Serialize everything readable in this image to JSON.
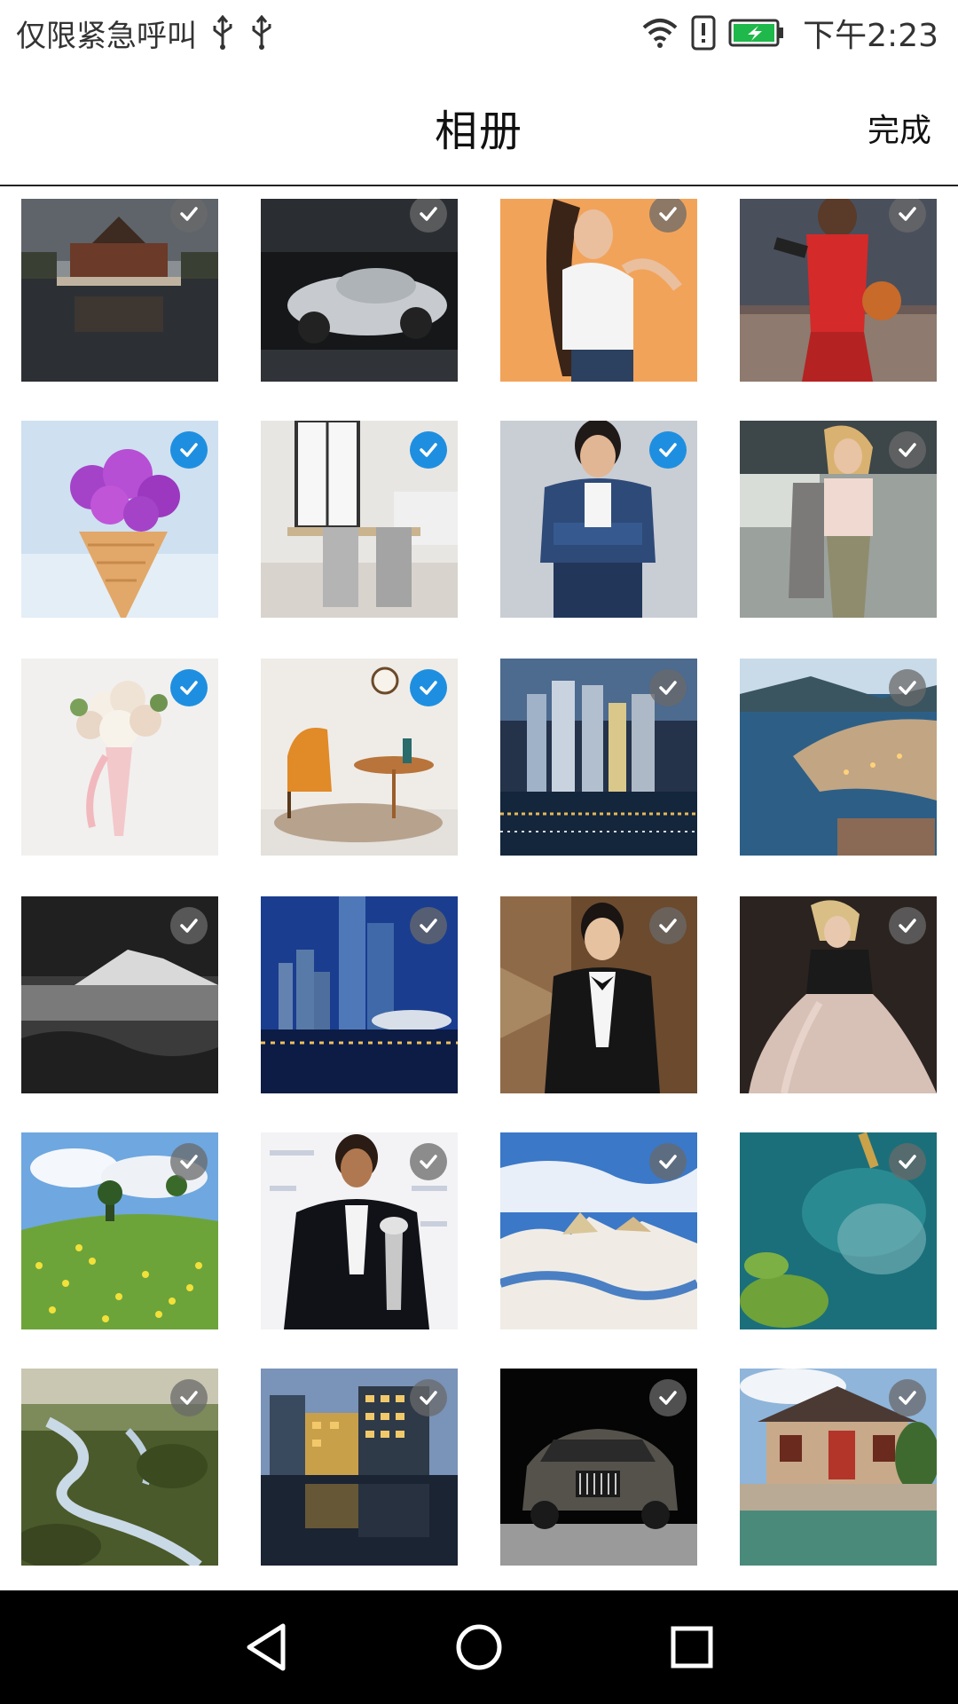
{
  "status_bar": {
    "carrier_text": "仅限紧急呼叫",
    "time": "下午2:23",
    "icons": [
      "usb-icon",
      "usb-icon",
      "wifi-icon",
      "alert-icon",
      "battery-charging-icon"
    ]
  },
  "header": {
    "title": "相册",
    "done_label": "完成"
  },
  "colors": {
    "selected_check": "#1e8fe0",
    "unselected_check": "#696969",
    "nav_bar": "#000000"
  },
  "gallery": {
    "rows": [
      {
        "items": [
          {
            "subject": "palace-tower-reflection",
            "selected": false
          },
          {
            "subject": "silver-sports-car",
            "selected": false
          },
          {
            "subject": "woman-orange-background",
            "selected": false
          },
          {
            "subject": "basketball-player",
            "selected": false
          }
        ]
      },
      {
        "items": [
          {
            "subject": "flower-cone",
            "selected": true
          },
          {
            "subject": "dining-room",
            "selected": true
          },
          {
            "subject": "man-denim-jacket",
            "selected": true
          },
          {
            "subject": "woman-olive-pants",
            "selected": false
          }
        ]
      },
      {
        "items": [
          {
            "subject": "rose-bouquet",
            "selected": true
          },
          {
            "subject": "orange-chair-table",
            "selected": true
          },
          {
            "subject": "city-night-harbor",
            "selected": false
          },
          {
            "subject": "lakeside-town",
            "selected": false
          }
        ]
      },
      {
        "items": [
          {
            "subject": "black-white-mountain",
            "selected": false
          },
          {
            "subject": "blue-skyscrapers",
            "selected": false
          },
          {
            "subject": "man-tuxedo-stairs",
            "selected": false
          },
          {
            "subject": "woman-gown-jacket",
            "selected": false
          }
        ]
      },
      {
        "items": [
          {
            "subject": "dandelion-meadow",
            "selected": false
          },
          {
            "subject": "man-trophy",
            "selected": false
          },
          {
            "subject": "desert-rocks",
            "selected": false
          },
          {
            "subject": "aerial-sea-boat",
            "selected": false
          }
        ]
      },
      {
        "items": [
          {
            "subject": "river-valley",
            "selected": false
          },
          {
            "subject": "glass-building-reflection",
            "selected": false
          },
          {
            "subject": "dark-suv",
            "selected": false
          },
          {
            "subject": "old-town-canal",
            "selected": false
          }
        ]
      }
    ]
  },
  "nav_bar": {
    "buttons": [
      "back-icon",
      "home-icon",
      "recents-icon"
    ]
  }
}
